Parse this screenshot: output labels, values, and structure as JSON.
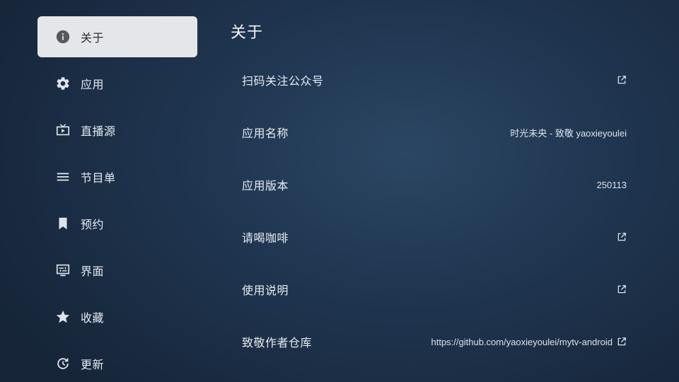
{
  "sidebar": {
    "items": [
      {
        "label": "关于",
        "icon": "info-icon",
        "active": true
      },
      {
        "label": "应用",
        "icon": "gear-icon"
      },
      {
        "label": "直播源",
        "icon": "live-tv-icon"
      },
      {
        "label": "节目单",
        "icon": "list-icon"
      },
      {
        "label": "预约",
        "icon": "bookmark-icon"
      },
      {
        "label": "界面",
        "icon": "display-settings-icon"
      },
      {
        "label": "收藏",
        "icon": "star-icon"
      },
      {
        "label": "更新",
        "icon": "refresh-icon"
      }
    ]
  },
  "main": {
    "title": "关于",
    "rows": [
      {
        "label": "扫码关注公众号",
        "value": "",
        "icon": "open-external-icon"
      },
      {
        "label": "应用名称",
        "value": "时光未央 - 致敬 yaoxieyoulei",
        "icon": ""
      },
      {
        "label": "应用版本",
        "value": "250113",
        "icon": ""
      },
      {
        "label": "请喝咖啡",
        "value": "",
        "icon": "open-external-icon"
      },
      {
        "label": "使用说明",
        "value": "",
        "icon": "open-external-icon"
      },
      {
        "label": "致敬作者仓库",
        "value": "https://github.com/yaoxieyoulei/mytv-android",
        "icon": "open-external-icon"
      }
    ]
  },
  "colors": {
    "active_bg": "#e4e6e9",
    "active_text": "#2a2d31",
    "text": "#e6ebf1",
    "background": "#1f3550"
  }
}
